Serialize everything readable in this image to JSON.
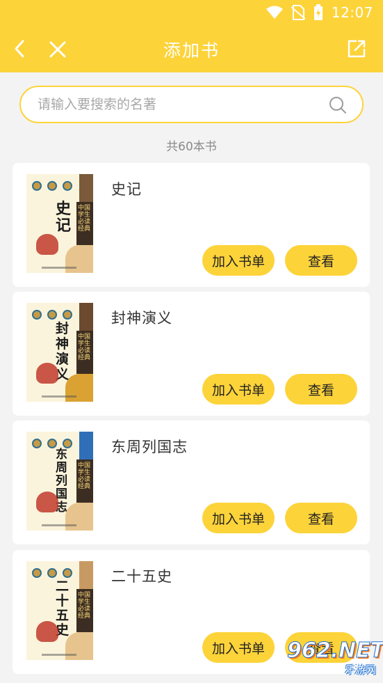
{
  "status_bar": {
    "time": "12:07"
  },
  "header": {
    "title": "添加书"
  },
  "search": {
    "placeholder": "请输入要搜索的名著",
    "value": ""
  },
  "summary": {
    "count_text": "共60本书"
  },
  "books": [
    {
      "name": "史记",
      "cover_title": "史记",
      "spine_color": "#7a5a3a",
      "cloud_color": "#e7c48d",
      "add_label": "加入书单",
      "view_label": "查看"
    },
    {
      "name": "封神演义",
      "cover_title": "封神演义",
      "spine_color": "#6b4a2f",
      "cloud_color": "#d9a233",
      "add_label": "加入书单",
      "view_label": "查看"
    },
    {
      "name": "东周列国志",
      "cover_title": "东周列国志",
      "spine_color": "#2f6fb8",
      "cloud_color": "#e7c48d",
      "add_label": "加入书单",
      "view_label": "查看"
    },
    {
      "name": "二十五史",
      "cover_title": "二十五史",
      "spine_color": "#c89a63",
      "cloud_color": "#e7c48d",
      "add_label": "加入书单",
      "view_label": "查看"
    }
  ],
  "cover_band_text": "中国学生必读经典",
  "watermark": {
    "logo": "962.NET",
    "sub": "乐游网"
  },
  "colors": {
    "accent": "#fdd33a",
    "background": "#f3f3f3",
    "card": "#ffffff"
  }
}
